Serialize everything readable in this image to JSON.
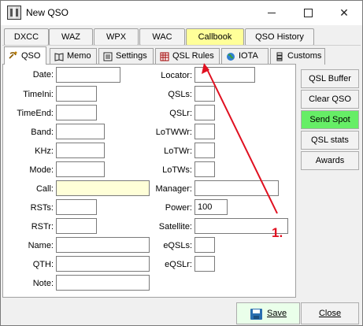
{
  "window": {
    "title": "New QSO"
  },
  "top_tabs": [
    "DXCC",
    "WAZ",
    "WPX",
    "WAC",
    "Callbook",
    "QSO History"
  ],
  "sub_tabs": [
    {
      "label": "QSO",
      "icon": "satellite-dish-icon"
    },
    {
      "label": "Memo",
      "icon": "book-icon"
    },
    {
      "label": "Settings",
      "icon": "list-icon"
    },
    {
      "label": "QSL Rules",
      "icon": "calendar-grid-icon"
    },
    {
      "label": "IOTA",
      "icon": "globe-icon"
    },
    {
      "label": "Customs",
      "icon": "stack-icon"
    }
  ],
  "form": {
    "date": {
      "label": "Date:",
      "value": ""
    },
    "time_ini": {
      "label": "TimeIni:",
      "value": ""
    },
    "time_end": {
      "label": "TimeEnd:",
      "value": ""
    },
    "band": {
      "label": "Band:",
      "value": ""
    },
    "khz": {
      "label": "KHz:",
      "value": ""
    },
    "mode": {
      "label": "Mode:",
      "value": ""
    },
    "call": {
      "label": "Call:",
      "value": ""
    },
    "rsts": {
      "label": "RSTs:",
      "value": ""
    },
    "rstr": {
      "label": "RSTr:",
      "value": ""
    },
    "name": {
      "label": "Name:",
      "value": ""
    },
    "qth": {
      "label": "QTH:",
      "value": ""
    },
    "note": {
      "label": "Note:",
      "value": ""
    },
    "locator": {
      "label": "Locator:",
      "value": ""
    },
    "qsls": {
      "label": "QSLs:",
      "value": ""
    },
    "qslr": {
      "label": "QSLr:",
      "value": ""
    },
    "lotw_wr": {
      "label": "LoTWWr:",
      "value": ""
    },
    "lotw_r": {
      "label": "LoTWr:",
      "value": ""
    },
    "lotw_s": {
      "label": "LoTWs:",
      "value": ""
    },
    "manager": {
      "label": "Manager:",
      "value": ""
    },
    "power": {
      "label": "Power:",
      "value": "100"
    },
    "satellite": {
      "label": "Satellite:",
      "value": ""
    },
    "eqsls": {
      "label": "eQSLs:",
      "value": ""
    },
    "eqslr": {
      "label": "eQSLr:",
      "value": ""
    }
  },
  "side_buttons": [
    "QSL Buffer",
    "Clear QSO",
    "Send Spot",
    "QSL stats",
    "Awards"
  ],
  "footer": {
    "save_label": "Save",
    "close_label": "Close"
  },
  "annotation": {
    "label": "1."
  },
  "colors": {
    "callbook_tab": "#ffff99",
    "send_spot": "#66ee66",
    "annotation": "#e01020",
    "call_field": "#ffffd8"
  }
}
